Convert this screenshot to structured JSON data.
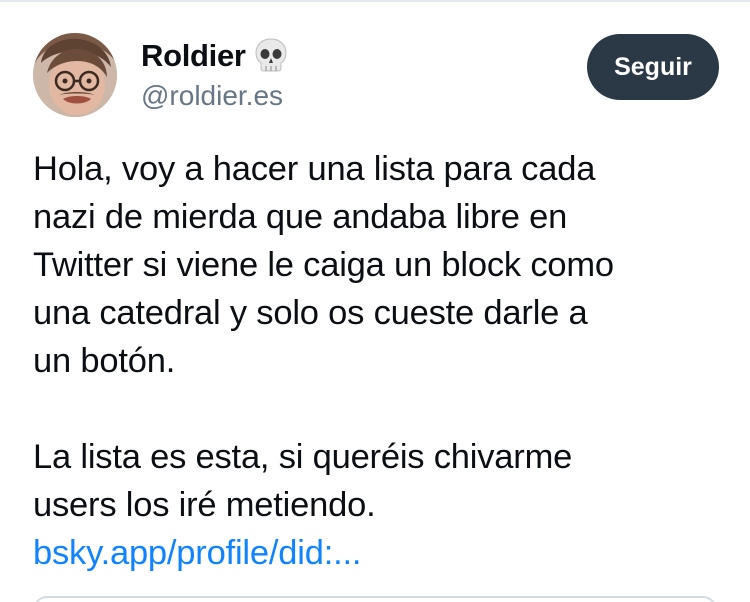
{
  "post": {
    "author": {
      "display_name": "Roldier",
      "name_emoji_icon": "skull-icon",
      "handle": "@roldier.es",
      "avatar_icon": "profile-photo"
    },
    "follow_label": "Seguir",
    "text_lines_p1": [
      "Hola, voy a hacer una lista para cada",
      "nazi de mierda que andaba libre en",
      "Twitter si viene le caiga un block como",
      "una catedral y solo os cueste darle a",
      "un botón."
    ],
    "text_lines_p2": [
      "La lista es esta, si queréis chivarme",
      "users los iré metiendo."
    ],
    "link_text": "bsky.app/profile/did:...",
    "colors": {
      "link": "#1083fe",
      "follow_button_bg": "#2b3846",
      "handle": "#667685"
    }
  }
}
